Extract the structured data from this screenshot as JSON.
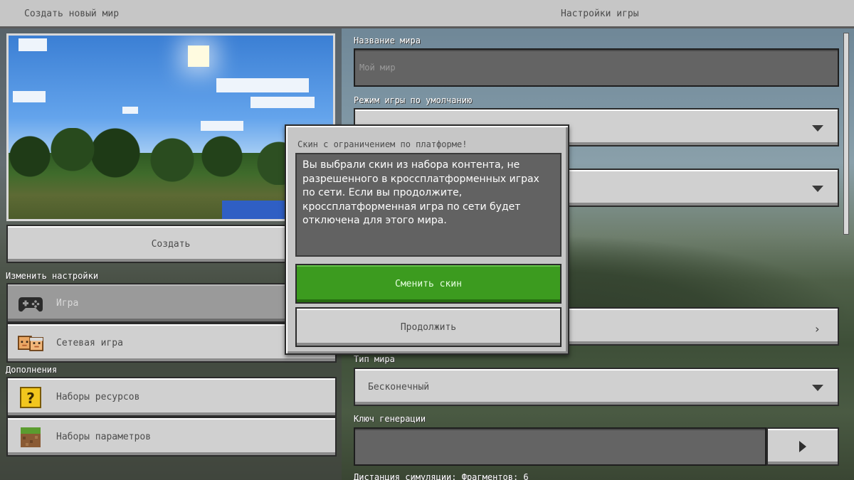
{
  "header": {
    "left_title": "Создать новый мир",
    "right_title": "Настройки игры"
  },
  "left": {
    "create_label": "Создать",
    "change_settings_label": "Изменить настройки",
    "items": [
      {
        "label": "Игра",
        "icon": "gamepad-icon"
      },
      {
        "label": "Сетевая игра",
        "icon": "multiplayer-icon"
      }
    ],
    "addons_label": "Дополнения",
    "addons": [
      {
        "label": "Наборы ресурсов",
        "icon": "resource-pack-icon"
      },
      {
        "label": "Наборы параметров",
        "icon": "behavior-pack-icon"
      }
    ]
  },
  "right": {
    "world_name_label": "Название мира",
    "world_name_placeholder": "Мой мир",
    "game_mode_label": "Режим игры по умолчанию",
    "world_type_label": "Тип мира",
    "world_type_value": "Бесконечный",
    "seed_label": "Ключ генерации",
    "sim_distance_label": "Дистанция симуляции: Фрагментов: 6"
  },
  "modal": {
    "title": "Скин с ограничением по платформе!",
    "body": "Вы выбрали скин из набора контента, не разрешенного в кроссплатформенных играх по сети. Если вы продолжите, кроссплатформенная игра по сети будет отключена для этого мира.",
    "primary_label": "Сменить скин",
    "secondary_label": "Продолжить"
  },
  "colors": {
    "accent_green": "#3c9b1f",
    "button_gray": "#d0d0d0",
    "field_dark": "#646464"
  }
}
